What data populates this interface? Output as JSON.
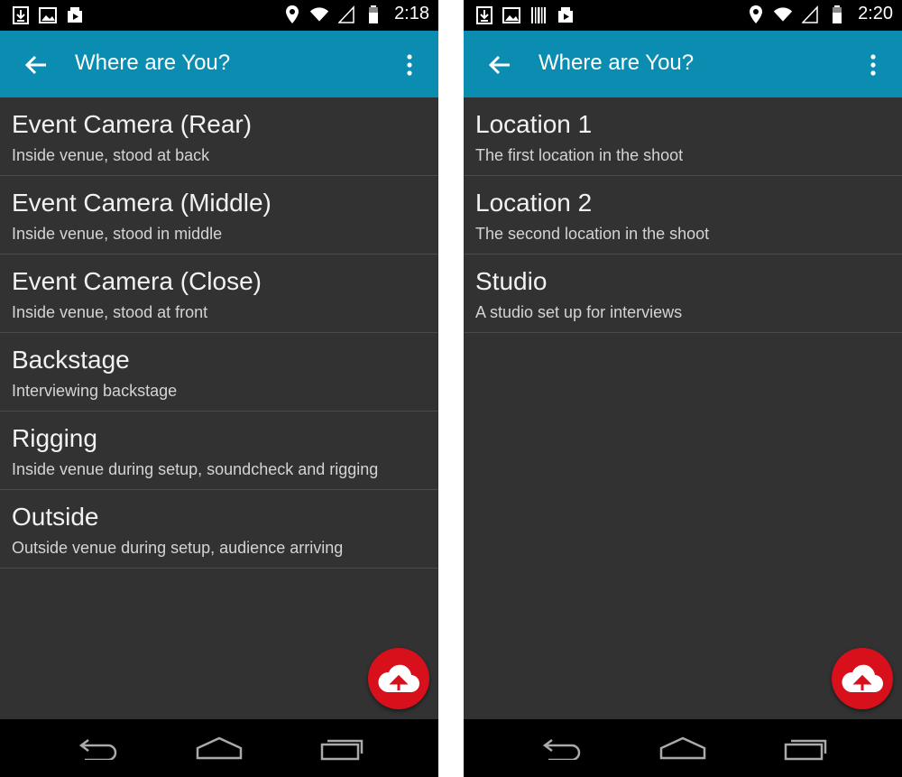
{
  "screens": [
    {
      "status_bar": {
        "time": "2:18",
        "left_icons": [
          "download-icon",
          "image-icon",
          "video-icon"
        ],
        "right_icons": [
          "location-icon",
          "wifi-icon",
          "signal-icon",
          "battery-icon"
        ]
      },
      "app_bar": {
        "title": "Where are You?"
      },
      "items": [
        {
          "title": "Event Camera (Rear)",
          "subtitle": "Inside venue, stood at back"
        },
        {
          "title": "Event Camera (Middle)",
          "subtitle": "Inside venue, stood in middle"
        },
        {
          "title": "Event Camera (Close)",
          "subtitle": "Inside venue, stood at front"
        },
        {
          "title": "Backstage",
          "subtitle": "Interviewing backstage"
        },
        {
          "title": "Rigging",
          "subtitle": "Inside venue during setup, soundcheck and rigging"
        },
        {
          "title": "Outside",
          "subtitle": "Outside venue during setup, audience arriving"
        }
      ]
    },
    {
      "status_bar": {
        "time": "2:20",
        "left_icons": [
          "download-icon",
          "image-icon",
          "barcode-icon",
          "video-icon"
        ],
        "right_icons": [
          "location-icon",
          "wifi-icon",
          "signal-icon",
          "battery-icon"
        ]
      },
      "app_bar": {
        "title": "Where are You?"
      },
      "items": [
        {
          "title": "Location 1",
          "subtitle": "The first location in the shoot"
        },
        {
          "title": "Location 2",
          "subtitle": "The second location in the shoot"
        },
        {
          "title": "Studio",
          "subtitle": "A studio set up for interviews"
        }
      ]
    }
  ],
  "colors": {
    "app_bar": "#0a8db0",
    "background": "#323232",
    "fab": "#d8101c",
    "status_bar": "#000000"
  },
  "fab": {
    "icon": "cloud-upload-icon"
  },
  "nav_bar": {
    "icons": [
      "nav-back-icon",
      "nav-home-icon",
      "nav-recents-icon"
    ]
  }
}
